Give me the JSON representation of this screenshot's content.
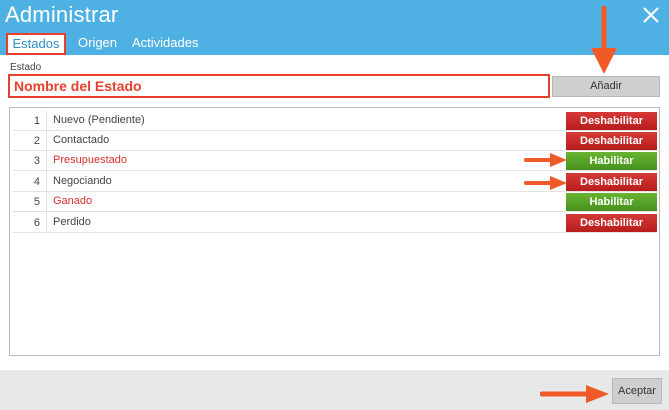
{
  "window": {
    "title": "Administrar"
  },
  "tabs": [
    {
      "label": "Estados"
    },
    {
      "label": "Origen"
    },
    {
      "label": "Actividades"
    }
  ],
  "form": {
    "label": "Estado",
    "placeholder": "Nombre del Estado",
    "add_label": "Añadir"
  },
  "states": [
    {
      "num": "1",
      "name": "Nuevo (Pendiente)",
      "action": "Deshabilitar"
    },
    {
      "num": "2",
      "name": "Contactado",
      "action": "Deshabilitar"
    },
    {
      "num": "3",
      "name": "Presupuestado",
      "action": "Habilitar"
    },
    {
      "num": "4",
      "name": "Negociando",
      "action": "Deshabilitar"
    },
    {
      "num": "5",
      "name": "Ganado",
      "action": "Habilitar"
    },
    {
      "num": "6",
      "name": "Perdido",
      "action": "Deshabilitar"
    }
  ],
  "footer": {
    "accept_label": "Aceptar"
  },
  "colors": {
    "header": "#4fb1e3",
    "highlight": "#e8402e",
    "disable_btn": "#c62828",
    "enable_btn": "#5aa527"
  }
}
